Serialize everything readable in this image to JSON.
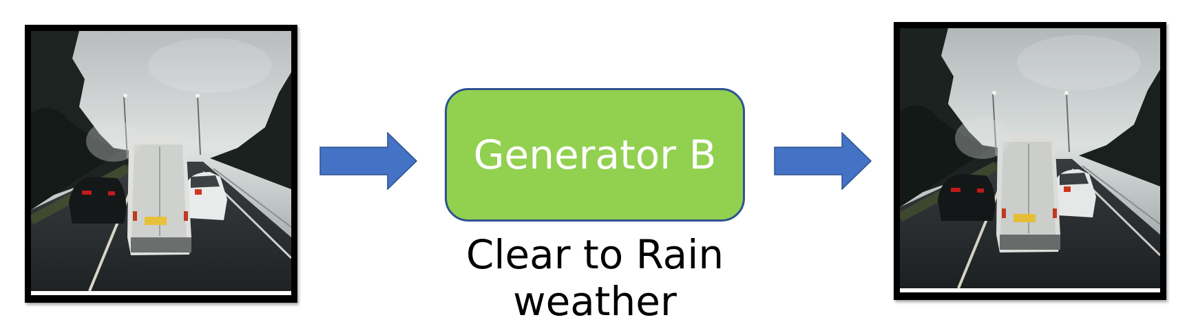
{
  "diagram": {
    "generator": {
      "label": "Generator B",
      "fill_color": "#92d050",
      "border_color": "#2f528f"
    },
    "caption": {
      "line1": "Clear to Rain",
      "line2": "weather"
    },
    "arrow_color": "#4472c4",
    "input_image": "rainy dashcam road scene with white van and cars",
    "output_image": "rainy dashcam road scene with white van and cars"
  }
}
